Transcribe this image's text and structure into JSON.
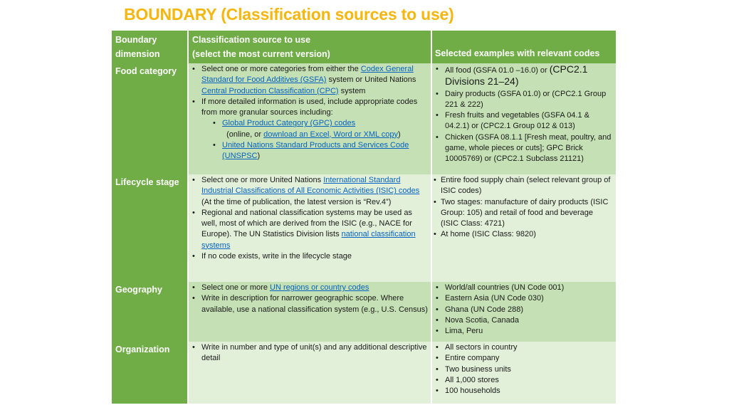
{
  "title": "BOUNDARY (Classification sources to use)",
  "colors": {
    "title": "#f5b70f",
    "header_bg": "#70ad47",
    "dimension_bg": "#70ad47",
    "row_dark": "#c5e0b4",
    "row_light": "#e2efd9",
    "link": "#0563c1"
  },
  "table": {
    "headers": {
      "dimension_line1": "Boundary",
      "dimension_line2": "dimension",
      "source_line1": "Classification source to use",
      "source_line2": "(select the most current version)",
      "examples": "Selected examples with relevant codes"
    },
    "rows": [
      {
        "dimension": "Food category",
        "source": {
          "b1_pre": "Select one or more categories from either the ",
          "b1_link": "Codex General Standard for Food Additives (GSFA)",
          "b1_mid": " system or United Nations ",
          "b1_link2": "Central Production Classification (CPC)",
          "b1_post": " system",
          "b2": "If more detailed information is used, include appropriate codes from more granular sources including:",
          "sub1_link": "Global Product Category (GPC) codes",
          "sub1_mid": "  (online, or ",
          "sub1_link2": "download an Excel, Word or XML copy",
          "sub1_post": ")",
          "sub2_link": "United Nations Standard Products and Services Code (UNSPSC",
          "sub2_post": ")"
        },
        "examples": {
          "e1_pre": "All food (GSFA 01.0 –16.0) or ",
          "e1_big": "(CPC2.1 Divisions 21–24)",
          "e2": "Dairy products (GSFA 01.0) or (CPC2.1 Group 221 & 222)",
          "e3": "Fresh fruits and vegetables (GSFA 04.1 & 04.2.1) or (CPC2.1 Group 012 & 013)",
          "e4": "Chicken (GSFA 08.1.1 [Fresh meat, poultry, and game, whole pieces or cuts]; GPC Brick 10005769) or (CPC2.1 Subclass 21121)"
        }
      },
      {
        "dimension": "Lifecycle stage",
        "source": {
          "b1_pre": "Select one or more United Nations ",
          "b1_link": "International Standard Industrial Classifications of All Economic Activities (ISIC) codes",
          "b1_post": "  (At the time of publication, the latest version is “Rev.4”)",
          "b2_pre": "Regional and national classification systems may be used as well, most of which are derived from the ISIC (e.g., NACE for Europe). The UN Statistics Division lists ",
          "b2_link": "national classification systems",
          "b3": "If no code exists, write in the lifecycle stage"
        },
        "examples": {
          "e1": "Entire food supply chain (select relevant group of ISIC codes)",
          "e2": "Two stages: manufacture of dairy products (ISIC Group: 105) and retail of food and beverage (ISIC Class: 4721)",
          "e3": "At home (ISIC Class: 9820)"
        }
      },
      {
        "dimension": "Geography",
        "source": {
          "b1_pre": "Select one or more ",
          "b1_link": "UN regions or country codes",
          "b2": "Write in description for narrower geographic scope. Where available, use a national classification system (e.g., U.S. Census)"
        },
        "examples": {
          "e1": "World/all countries (UN Code 001)",
          "e2": "Eastern Asia (UN Code 030)",
          "e3": "Ghana (UN Code 288)",
          "e4": "Nova Scotia, Canada",
          "e5": "Lima, Peru"
        }
      },
      {
        "dimension": "Organization",
        "source": {
          "b1": "Write in number and type of unit(s) and any additional descriptive detail"
        },
        "examples": {
          "e1": "All sectors in country",
          "e2": "Entire company",
          "e3": "Two business units",
          "e4": "All 1,000 stores",
          "e5": "100 households"
        }
      }
    ]
  }
}
